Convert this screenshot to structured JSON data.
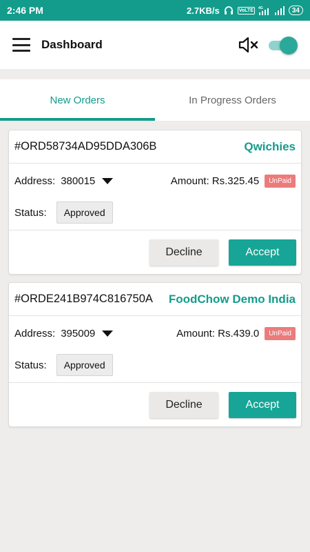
{
  "status_bar": {
    "time": "2:46 PM",
    "net_speed": "2.7KB/s",
    "volte": "VoLTE",
    "network_type": "4G",
    "battery": "34"
  },
  "appbar": {
    "title": "Dashboard",
    "sound_muted": true,
    "toggle_on": true
  },
  "tabs": [
    {
      "label": "New Orders",
      "active": true
    },
    {
      "label": "In Progress Orders",
      "active": false
    }
  ],
  "orders": [
    {
      "order_id": "#ORD58734AD95DDA306B",
      "restaurant": "Qwichies",
      "address_label": "Address:",
      "address": "380015",
      "amount": "Amount: Rs.325.45",
      "payment_status": "UnPaid",
      "status_label": "Status:",
      "status": "Approved",
      "decline_label": "Decline",
      "accept_label": "Accept"
    },
    {
      "order_id": "#ORDE241B974C816750A",
      "restaurant": "FoodChow Demo India",
      "address_label": "Address:",
      "address": "395009",
      "amount": "Amount: Rs.439.0",
      "payment_status": "UnPaid",
      "status_label": "Status:",
      "status": "Approved",
      "decline_label": "Decline",
      "accept_label": "Accept"
    }
  ],
  "colors": {
    "primary": "#139c8c",
    "accept_button": "#16a596",
    "unpaid_badge": "#ec7b7b",
    "background": "#efedeb"
  }
}
